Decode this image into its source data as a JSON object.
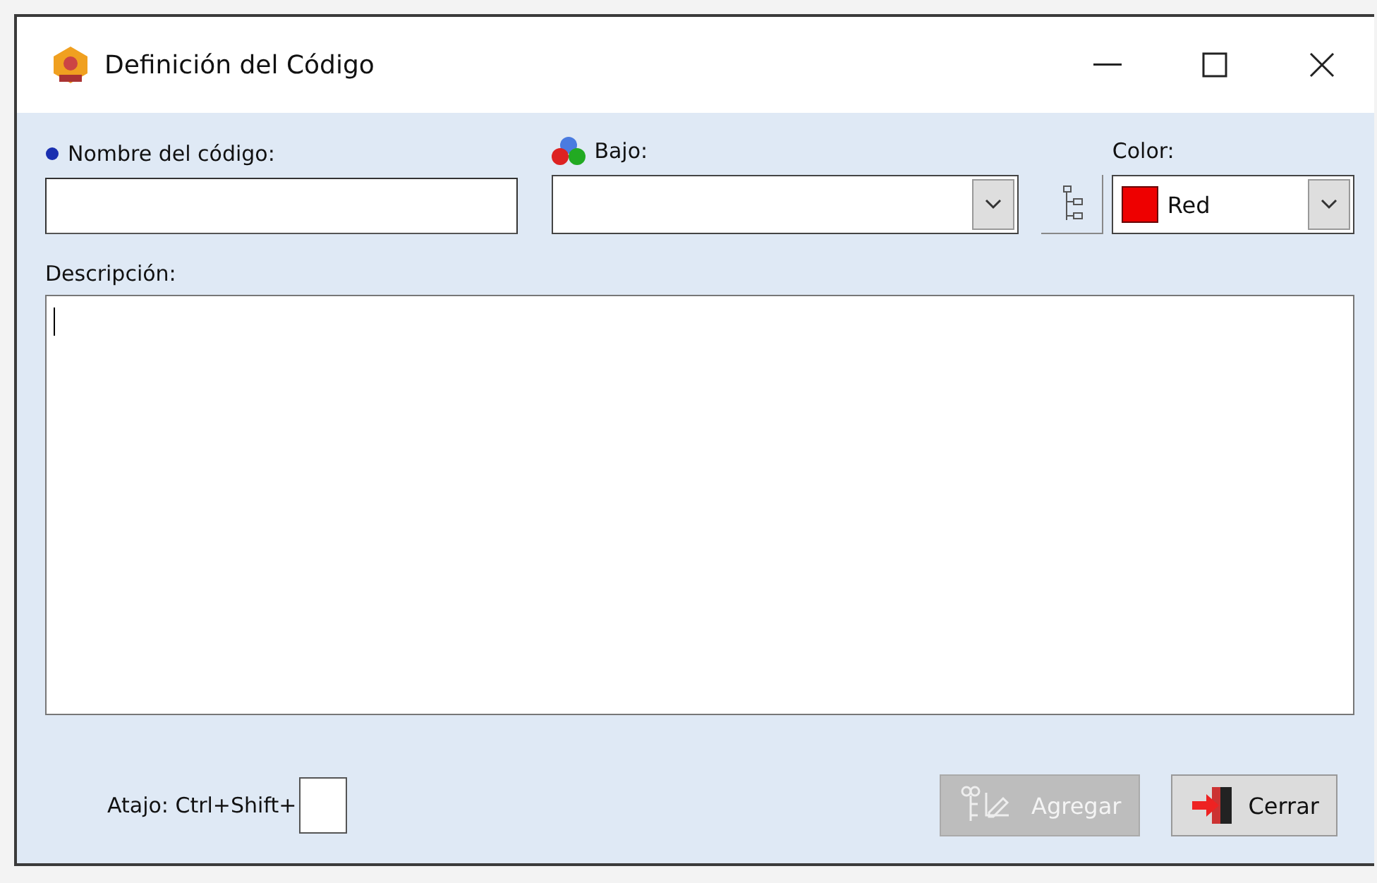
{
  "window": {
    "title": "Definición del Código"
  },
  "name_field": {
    "label": "Nombre del código:",
    "required": true
  },
  "under_field": {
    "label": "Bajo:"
  },
  "color_field": {
    "label": "Color:",
    "value": "Red",
    "color": "#ee0000"
  },
  "description": {
    "label": "Descripción:",
    "focused": true
  },
  "shortcut": {
    "label": "Atajo: Ctrl+Shift+"
  },
  "buttons": [
    {
      "kind": "add",
      "label": "Agregar",
      "disabled": true
    },
    {
      "kind": "close",
      "label": "Cerrar",
      "disabled": false
    }
  ]
}
